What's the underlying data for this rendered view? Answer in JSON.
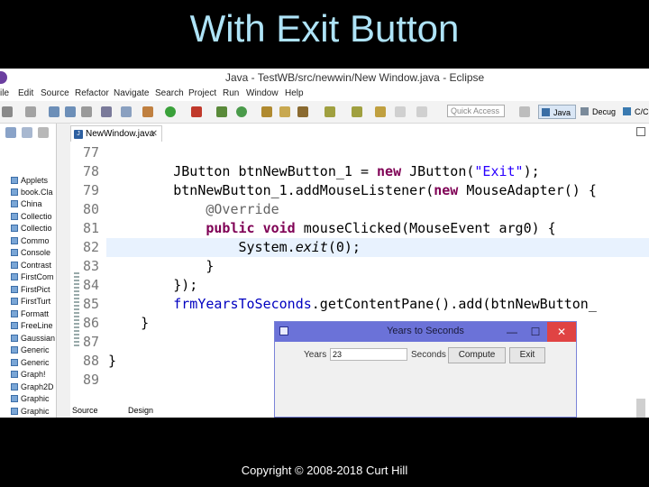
{
  "slide": {
    "title": "With Exit Button",
    "footer": "Copyright © 2008-2018 Curt Hill"
  },
  "window": {
    "title": "Java - TestWB/src/newwin/New Window.java - Eclipse"
  },
  "menu": [
    "ile",
    "Edit",
    "Source",
    "Refactor",
    "Navigate",
    "Search",
    "Project",
    "Run",
    "Window",
    "Help"
  ],
  "toolbar": {
    "quick_access": "Quick Access",
    "perspectives": [
      "Java",
      "Decug",
      "C/C++"
    ]
  },
  "package_explorer": {
    "items": [
      "Applets",
      "book.Cla",
      "China",
      "Collectio",
      "Collectio",
      "Commo",
      "Console",
      "Contrast",
      "FirstCom",
      "FirstPict",
      "FirstTurt",
      "Formatt",
      "FreeLine",
      "Gaussian",
      "Generic",
      "Generic",
      "Graph!",
      "Graph2D",
      "Graphic",
      "Graphic"
    ]
  },
  "editor": {
    "tab_label": "NewWindow.java",
    "tab_close": "✕",
    "highlight_line": 82,
    "lines": [
      {
        "n": "77",
        "segments": []
      },
      {
        "n": "78",
        "segments": [
          {
            "t": "        JButton btnNew",
            "c": ""
          },
          {
            "t": "Button_1 = ",
            "c": ""
          },
          {
            "t": "new",
            "c": "kw"
          },
          {
            "t": " JButton(",
            "c": ""
          },
          {
            "t": "\"Exit\"",
            "c": "str"
          },
          {
            "t": ");",
            "c": ""
          }
        ]
      },
      {
        "n": "79",
        "segments": [
          {
            "t": "        btnNewButton_1.addMouseListener(",
            "c": ""
          },
          {
            "t": "new",
            "c": "kw"
          },
          {
            "t": " MouseAdapter() {",
            "c": ""
          }
        ]
      },
      {
        "n": "80",
        "segments": [
          {
            "t": "            ",
            "c": ""
          },
          {
            "t": "@Override",
            "c": "ann"
          }
        ]
      },
      {
        "n": "81",
        "segments": [
          {
            "t": "            ",
            "c": ""
          },
          {
            "t": "public",
            "c": "kw"
          },
          {
            "t": " ",
            "c": ""
          },
          {
            "t": "void",
            "c": "kw"
          },
          {
            "t": " mouseClicked(MouseEvent arg0) {",
            "c": ""
          }
        ]
      },
      {
        "n": "82",
        "segments": [
          {
            "t": "                System.",
            "c": ""
          },
          {
            "t": "exit",
            "c": "it"
          },
          {
            "t": "(0);",
            "c": ""
          }
        ]
      },
      {
        "n": "83",
        "segments": [
          {
            "t": "            }",
            "c": ""
          }
        ]
      },
      {
        "n": "84",
        "segments": [
          {
            "t": "        });",
            "c": ""
          }
        ]
      },
      {
        "n": "85",
        "segments": [
          {
            "t": "        ",
            "c": ""
          },
          {
            "t": "frmYearsToSeconds",
            "c": "fld"
          },
          {
            "t": ".getContentPane().add(btnNewButton_",
            "c": ""
          }
        ]
      },
      {
        "n": "86",
        "segments": [
          {
            "t": "    }",
            "c": ""
          }
        ]
      },
      {
        "n": "87",
        "segments": []
      },
      {
        "n": "88",
        "segments": [
          {
            "t": "}",
            "c": ""
          }
        ]
      },
      {
        "n": "89",
        "segments": []
      }
    ],
    "bottom_tabs": [
      "Source",
      "Design"
    ]
  },
  "dialog": {
    "title": "Years to Seconds",
    "min": "—",
    "max": "☐",
    "close": "✕",
    "years_label": "Years",
    "years_value": "23",
    "seconds_label": "Seconds",
    "compute_label": "Compute",
    "exit_label": "Exit"
  }
}
